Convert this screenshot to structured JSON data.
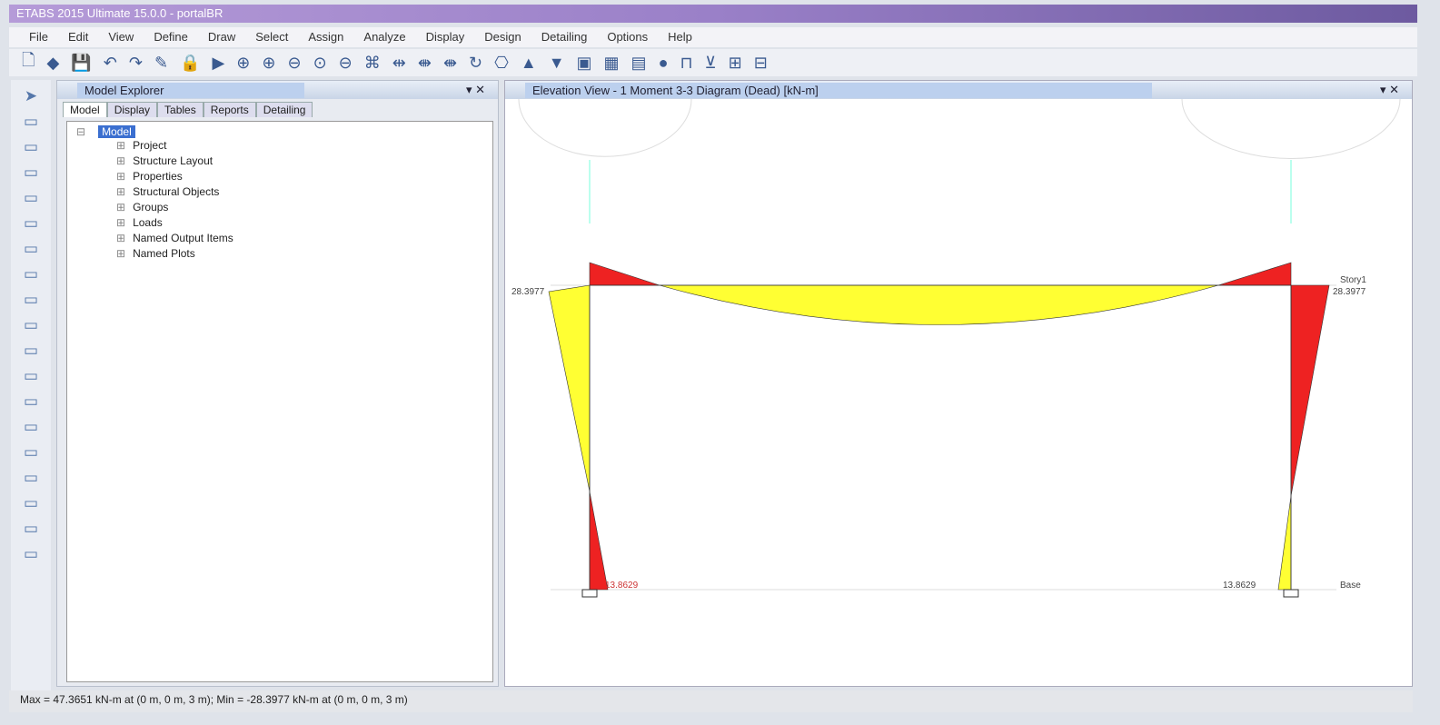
{
  "window": {
    "title": "ETABS 2015 Ultimate 15.0.0 - portalBR"
  },
  "menu": [
    "File",
    "Edit",
    "View",
    "Define",
    "Draw",
    "Select",
    "Assign",
    "Analyze",
    "Display",
    "Design",
    "Detailing",
    "Options",
    "Help"
  ],
  "toolbar_icons": [
    "new",
    "open",
    "save",
    "undo",
    "redo",
    "pencil",
    "lock",
    "run",
    "zoom-window",
    "zoom-in",
    "zoom-out",
    "zoom-restore",
    "zoom-previous",
    "3d-view",
    "plan",
    "elevation",
    "elevation-2",
    "rotate",
    "perspective",
    "move-up",
    "move-down",
    "object-shrink",
    "show-grid",
    "display",
    "view-options",
    "line",
    "column",
    "beam",
    "brace"
  ],
  "explorer": {
    "title": "Model Explorer",
    "tabs": [
      "Model",
      "Display",
      "Tables",
      "Reports",
      "Detailing"
    ],
    "root": "Model",
    "items": [
      "Project",
      "Structure Layout",
      "Properties",
      "Structural Objects",
      "Groups",
      "Loads",
      "Named Output Items",
      "Named Plots"
    ]
  },
  "view": {
    "title": "Elevation View - 1   Moment 3-3 Diagram   (Dead)  [kN-m]",
    "labels": {
      "left_top": "28.3977",
      "right_top": "28.3977",
      "story": "Story1",
      "base": "Base",
      "left_base": "13.8629",
      "right_base": "13.8629"
    },
    "colors": {
      "positive": "#ffff33",
      "negative": "#ee2222"
    }
  },
  "status": "Max = 47.3651 kN-m at (0 m, 0 m, 3 m);  Min = -28.3977 kN-m at (0 m, 0 m, 3 m)"
}
